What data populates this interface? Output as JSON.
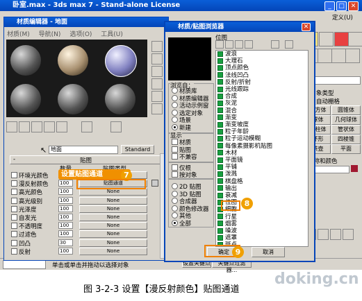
{
  "main_window": {
    "title": "卧室.max - 3ds max 7 - Stand-alone License",
    "right_menu": "定义(U)"
  },
  "material_editor": {
    "title": "材质编辑器 - 地面",
    "menu": [
      "材质(M)",
      "导航(N)",
      "选项(O)",
      "工具(U)"
    ],
    "material_name": "地面",
    "material_type": "Standard",
    "maps_header": "贴图",
    "amount_header": "数量",
    "map_type_header": "贴图类型",
    "rows": [
      {
        "label": "环境光颜色",
        "amount": "100",
        "map": "None"
      },
      {
        "label": "漫反射颜色",
        "amount": "100",
        "map": "贴图通道"
      },
      {
        "label": "高光颜色",
        "amount": "100",
        "map": "None"
      },
      {
        "label": "高光级别",
        "amount": "100",
        "map": "None"
      },
      {
        "label": "光泽度",
        "amount": "100",
        "map": "None"
      },
      {
        "label": "自发光",
        "amount": "100",
        "map": "None"
      },
      {
        "label": "不透明度",
        "amount": "100",
        "map": "None"
      },
      {
        "label": "过滤色",
        "amount": "100",
        "map": "None"
      },
      {
        "label": "凹凸",
        "amount": "30",
        "map": "None"
      },
      {
        "label": "反射",
        "amount": "100",
        "map": "None"
      }
    ],
    "callout_text": "设置贴图通道",
    "callout_num": "7"
  },
  "browser": {
    "title": "材质/贴图浏览器",
    "header": "位图",
    "browse_from_title": "浏览自：",
    "browse_from": [
      {
        "label": "材质库",
        "on": false
      },
      {
        "label": "材质编辑器",
        "on": false
      },
      {
        "label": "活动示例窗",
        "on": false
      },
      {
        "label": "选定对象",
        "on": false
      },
      {
        "label": "场景",
        "on": false
      },
      {
        "label": "新建",
        "on": true
      }
    ],
    "show_title": "显示",
    "show_opts": [
      "材质",
      "贴图",
      "不兼容"
    ],
    "show_opts2": [
      "仅根",
      "按对象"
    ],
    "type_opts": [
      {
        "label": "2D 贴图",
        "on": false
      },
      {
        "label": "3D 贴图",
        "on": false
      },
      {
        "label": "合成器",
        "on": false
      },
      {
        "label": "颜色修改器",
        "on": false
      },
      {
        "label": "其他",
        "on": false
      },
      {
        "label": "全部",
        "on": true
      }
    ],
    "maps": [
      "波浪",
      "大理石",
      "顶点颜色",
      "法线凹凸",
      "反射/折射",
      "光线跟踪",
      "合成",
      "灰泥",
      "混合",
      "渐变",
      "渐变坡度",
      "粒子年龄",
      "粒子运动模糊",
      "每像素摄影机贴图",
      "木材",
      "平面镜",
      "平铺",
      "泼溅",
      "棋盘格",
      "输出",
      "衰减",
      "位图",
      "细胞",
      "行星",
      "烟雾",
      "噪波",
      "遮罩",
      "斑点"
    ],
    "ok": "确定",
    "cancel": "取消",
    "callout8": "8",
    "callout9": "9"
  },
  "right_panel": {
    "obj_type": "象类型",
    "auto_grid": "自动栅格",
    "buttons": [
      [
        "长方体",
        "圆锥体"
      ],
      [
        "球体",
        "几何球体"
      ],
      [
        "圆柱体",
        "管状体"
      ],
      [
        "环形",
        "四棱锥"
      ],
      [
        "茶壶",
        "平面"
      ]
    ],
    "name_color": "名称和颜色"
  },
  "status": {
    "prompt": "单击或单击并拖动以选择对象",
    "btn1": "设置关键点",
    "btn2": "关键点过滤器..."
  },
  "caption": "图 3-2-3  设置【漫反射颜色】贴图通道",
  "watermark": "doking.cn"
}
